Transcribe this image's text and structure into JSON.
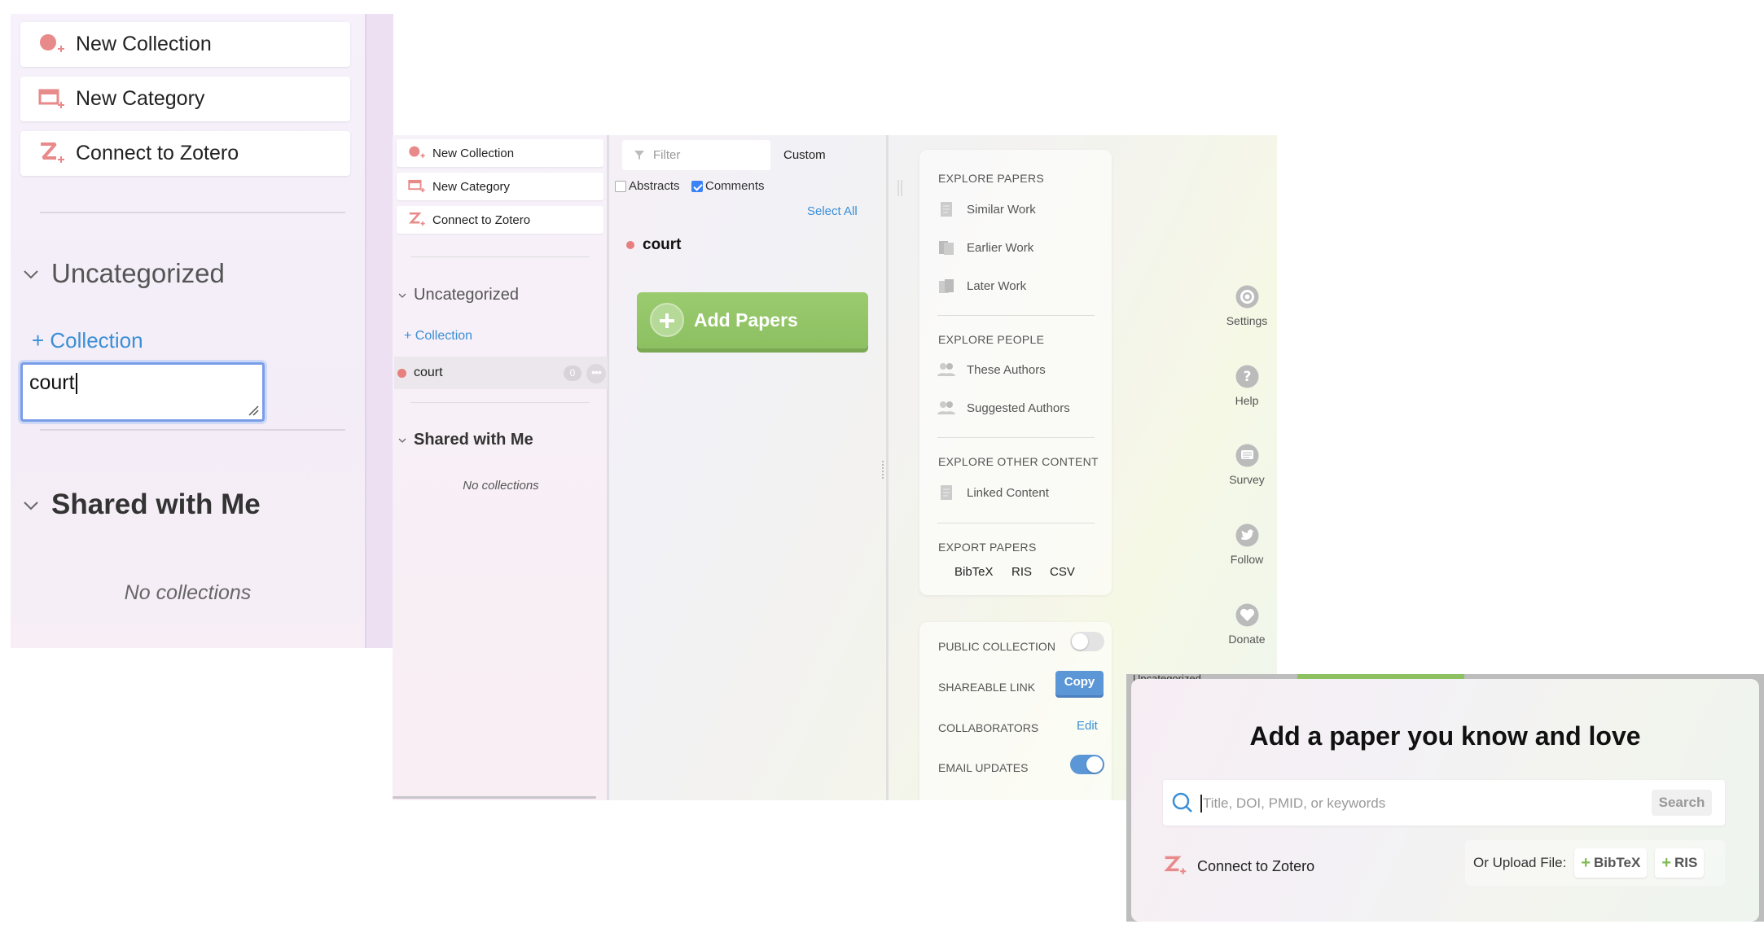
{
  "panel_a": {
    "buttons": [
      "New Collection",
      "New Category",
      "Connect to Zotero"
    ],
    "uncategorized": "Uncategorized",
    "add_collection": "+ Collection",
    "new_collection_input": "court",
    "shared_with_me": "Shared with Me",
    "no_collections": "No collections"
  },
  "sidebar": {
    "buttons": [
      "New Collection",
      "New Category",
      "Connect to Zotero"
    ],
    "uncategorized": "Uncategorized",
    "add_collection": "+ Collection",
    "collection": {
      "name": "court",
      "count": "0",
      "more": "•••"
    },
    "shared_with_me": "Shared with Me",
    "no_collections": "No collections"
  },
  "main": {
    "filter_placeholder": "Filter",
    "sort": "Custom",
    "abstracts": "Abstracts",
    "comments": "Comments",
    "abstracts_checked": false,
    "comments_checked": true,
    "select_all": "Select All",
    "collection_title": "court",
    "add_papers": "Add Papers"
  },
  "explore": {
    "papers_heading": "EXPLORE PAPERS",
    "papers": [
      "Similar Work",
      "Earlier Work",
      "Later Work"
    ],
    "people_heading": "EXPLORE PEOPLE",
    "people": [
      "These Authors",
      "Suggested Authors"
    ],
    "other_heading": "EXPLORE OTHER CONTENT",
    "other": [
      "Linked Content"
    ],
    "export_heading": "EXPORT PAPERS",
    "export": [
      "BibTeX",
      "RIS",
      "CSV"
    ]
  },
  "collection_settings": {
    "public_label": "PUBLIC COLLECTION",
    "public_on": false,
    "link_label": "SHAREABLE LINK",
    "copy": "Copy",
    "collaborators_label": "COLLABORATORS",
    "edit": "Edit",
    "email_label": "EMAIL UPDATES",
    "email_on": true
  },
  "side_menu": {
    "settings": "Settings",
    "help": "Help",
    "survey": "Survey",
    "follow": "Follow",
    "donate": "Donate"
  },
  "dialog": {
    "peek_text": "Uncategorized",
    "title": "Add a paper you know and love",
    "search_placeholder": "Title, DOI, PMID, or keywords",
    "search_button": "Search",
    "zotero": "Connect to Zotero",
    "upload_label": "Or Upload File:",
    "bibtex": "BibTeX",
    "ris": "RIS"
  },
  "colors": {
    "accent_blue": "#3a8fd6",
    "add_green": "#8cc061",
    "collection_dot": "#e77f7f",
    "icon_red": "#e88a8a",
    "toggle_on": "#5b97d6"
  },
  "icons": {
    "new_collection": "circle-plus-icon",
    "new_category": "folder-plus-icon",
    "zotero": "zotero-z-icon"
  }
}
